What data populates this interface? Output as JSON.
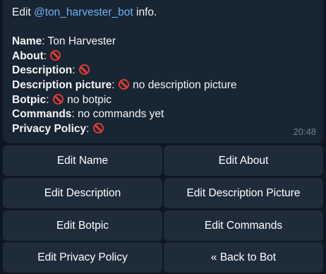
{
  "message": {
    "header_prefix": "Edit ",
    "mention": "@ton_harvester_bot",
    "header_suffix": " info.",
    "fields": [
      {
        "label": "Name",
        "value": ": Ton Harvester"
      },
      {
        "label": "About",
        "value": ": "
      },
      {
        "label": "Description",
        "value": ": "
      },
      {
        "label": "Description picture",
        "value": ": ",
        "note": " no description picture"
      },
      {
        "label": "Botpic",
        "value": ": ",
        "note": " no botpic"
      },
      {
        "label": "Commands",
        "value": ": no commands yet"
      },
      {
        "label": "Privacy Policy",
        "value": ": "
      }
    ],
    "time": "20:48"
  },
  "buttons": {
    "edit_name": "Edit Name",
    "edit_about": "Edit About",
    "edit_description": "Edit Description",
    "edit_description_picture": "Edit Description Picture",
    "edit_botpic": "Edit Botpic",
    "edit_commands": "Edit Commands",
    "edit_privacy_policy": "Edit Privacy Policy",
    "back_to_bot": "« Back to Bot"
  },
  "icons": {
    "not_set": "no-entry-icon"
  },
  "colors": {
    "background": "#0e1621",
    "bubble": "#182533",
    "button": "#1e2c3a",
    "mention": "#6ab3f3",
    "not_set_icon": "#e53935",
    "timestamp": "#6d7f8f"
  }
}
